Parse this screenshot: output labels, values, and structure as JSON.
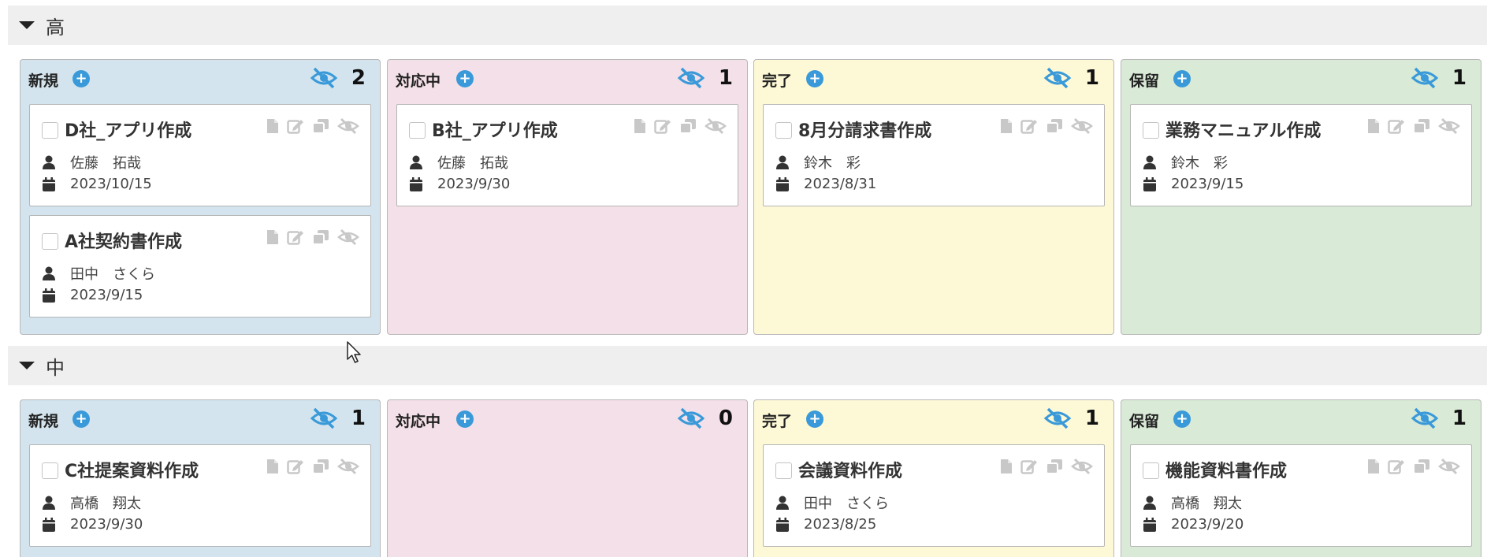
{
  "groups": [
    {
      "title": "高",
      "lanes": [
        {
          "title": "新規",
          "count": "2",
          "cards": [
            {
              "title": "D社_アプリ作成",
              "assignee": "佐藤　拓哉",
              "date": "2023/10/15"
            },
            {
              "title": "A社契約書作成",
              "assignee": "田中　さくら",
              "date": "2023/9/15"
            }
          ]
        },
        {
          "title": "対応中",
          "count": "1",
          "cards": [
            {
              "title": "B社_アプリ作成",
              "assignee": "佐藤　拓哉",
              "date": "2023/9/30"
            }
          ]
        },
        {
          "title": "完了",
          "count": "1",
          "cards": [
            {
              "title": "8月分請求書作成",
              "assignee": "鈴木　彩",
              "date": "2023/8/31"
            }
          ]
        },
        {
          "title": "保留",
          "count": "1",
          "cards": [
            {
              "title": "業務マニュアル作成",
              "assignee": "鈴木　彩",
              "date": "2023/9/15"
            }
          ]
        }
      ]
    },
    {
      "title": "中",
      "lanes": [
        {
          "title": "新規",
          "count": "1",
          "cards": [
            {
              "title": "C社提案資料作成",
              "assignee": "高橋　翔太",
              "date": "2023/9/30"
            }
          ]
        },
        {
          "title": "対応中",
          "count": "0",
          "cards": []
        },
        {
          "title": "完了",
          "count": "1",
          "cards": [
            {
              "title": "会議資料作成",
              "assignee": "田中　さくら",
              "date": "2023/8/25"
            }
          ]
        },
        {
          "title": "保留",
          "count": "1",
          "cards": [
            {
              "title": "機能資料書作成",
              "assignee": "高橋　翔太",
              "date": "2023/9/20"
            }
          ]
        }
      ]
    }
  ],
  "icons": {
    "group_toggle": "caret-down-icon",
    "add": "plus-circle-icon",
    "hide_lane": "eye-slash-icon",
    "card_actions": [
      "file-icon",
      "edit-icon",
      "copy-icon",
      "eye-slash-icon"
    ],
    "assignee": "user-icon",
    "date": "calendar-icon"
  },
  "colors": {
    "accent": "#3a9ad9",
    "lane_new": "#d3e4ee",
    "lane_doing": "#f4e0e8",
    "lane_done": "#fdf8d6",
    "lane_hold": "#d9ead6",
    "group_header": "#efefef"
  }
}
